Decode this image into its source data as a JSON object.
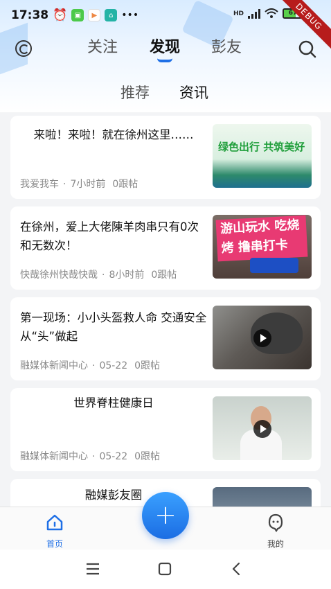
{
  "status_bar": {
    "time": "17:38",
    "battery": "67",
    "network": "HD",
    "debug_label": "DEBUG"
  },
  "top_nav": {
    "tabs": [
      {
        "label": "关注",
        "active": false
      },
      {
        "label": "发现",
        "active": true
      },
      {
        "label": "彭友",
        "active": false
      }
    ],
    "accent_color": "#1e6fe6"
  },
  "sub_tabs": [
    {
      "label": "推荐",
      "active": false
    },
    {
      "label": "资讯",
      "active": true
    }
  ],
  "feed": [
    {
      "title": "来啦！来啦！就在徐州这里……",
      "source": "我爱我车",
      "time": "7小时前",
      "replies": "0跟帖",
      "thumb_text": "绿色出行 共筑美好",
      "video": false
    },
    {
      "title": "在徐州，爱上大佬陳羊肉串只有0次和无数次！",
      "source": "快哉徐州快哉快哉",
      "time": "8小时前",
      "replies": "0跟帖",
      "thumb_text": "游山玩水 吃烧烤 撸串打卡",
      "video": false
    },
    {
      "title": "第一现场：小小头盔救人命 交通安全从“头”做起",
      "source": "融媒体新闻中心",
      "time": "05-22",
      "replies": "0跟帖",
      "video": true
    },
    {
      "title": "世界脊柱健康日",
      "source": "融媒体新闻中心",
      "time": "05-22",
      "replies": "0跟帖",
      "video": true
    },
    {
      "title": "融媒彭友圈",
      "video": false
    }
  ],
  "bottom_nav": {
    "items": [
      {
        "label": "首页",
        "icon": "home-icon",
        "active": true
      },
      {
        "label": "我的",
        "icon": "profile-icon",
        "active": false
      }
    ],
    "fab_label": "+"
  }
}
